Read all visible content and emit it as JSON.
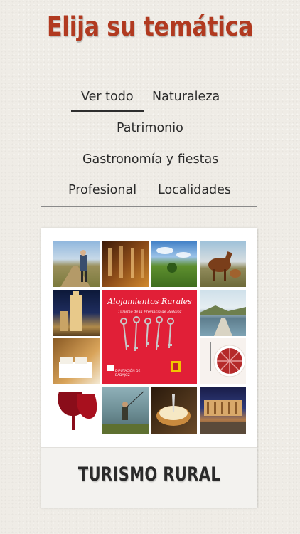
{
  "header": {
    "title": "Elija su temática"
  },
  "filters": {
    "items": [
      {
        "label": "Ver todo",
        "active": true
      },
      {
        "label": "Naturaleza",
        "active": false
      },
      {
        "label": "Patrimonio",
        "active": false
      },
      {
        "label": "Gastronomía y fiestas",
        "active": false
      },
      {
        "label": "Profesional",
        "active": false
      },
      {
        "label": "Localidades",
        "active": false
      }
    ]
  },
  "card": {
    "title": "TURISMO RURAL",
    "cover": {
      "title": "Alojamientos Rurales",
      "subtitle": "Turismo de la Provincia de Badajoz",
      "org": "DIPUTACIÓN DE BADAJOZ"
    }
  },
  "colors": {
    "title": "#b13a20",
    "background": "#efece6",
    "cover_red": "#e11f37",
    "text": "#2b2b2b"
  }
}
